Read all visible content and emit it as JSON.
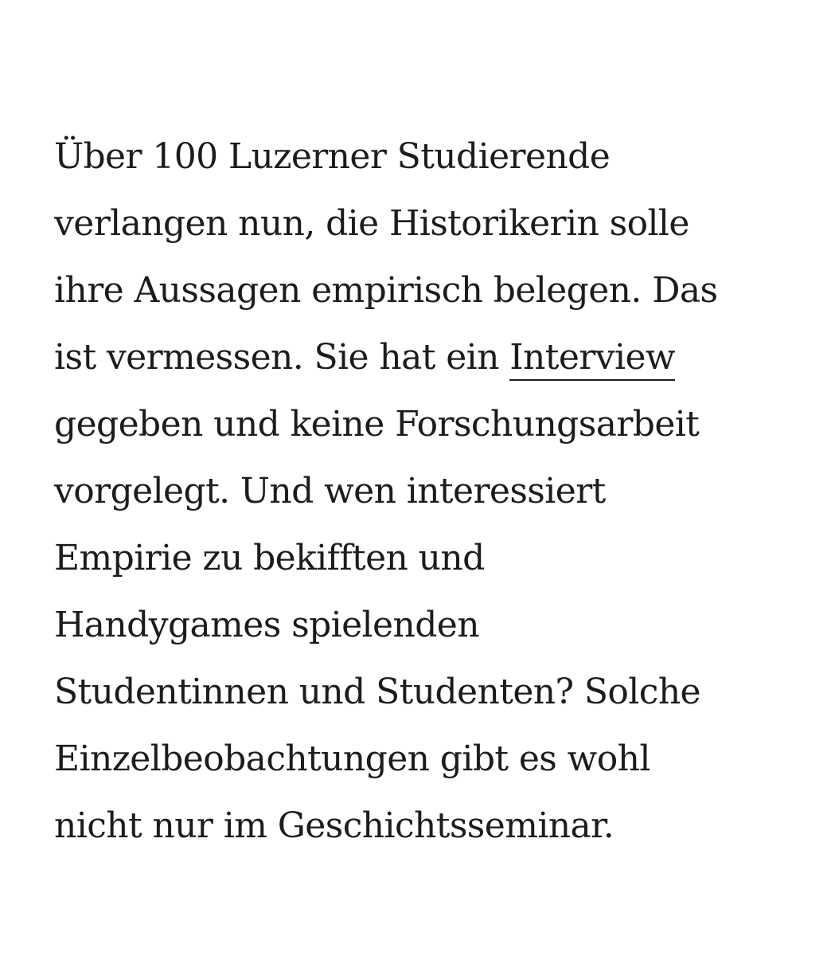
{
  "article": {
    "lines": [
      "Über 100 Luzerner Studierende",
      "verlangen nun, die Historikerin solle",
      "ihre Aussagen empirisch belegen. Das",
      "",
      "gegeben und keine Forschungsarbeit",
      "vorgelegt. Und wen interessiert",
      "Empirie zu bekifften und",
      "Handygames spielenden",
      "Studentinnen und Studenten? Solche",
      "Einzelbeobachtungen gibt es wohl",
      "nicht nur im Geschichtsseminar."
    ],
    "line4_before_link": "ist vermessen. Sie hat ein ",
    "link_text": "Interview"
  }
}
